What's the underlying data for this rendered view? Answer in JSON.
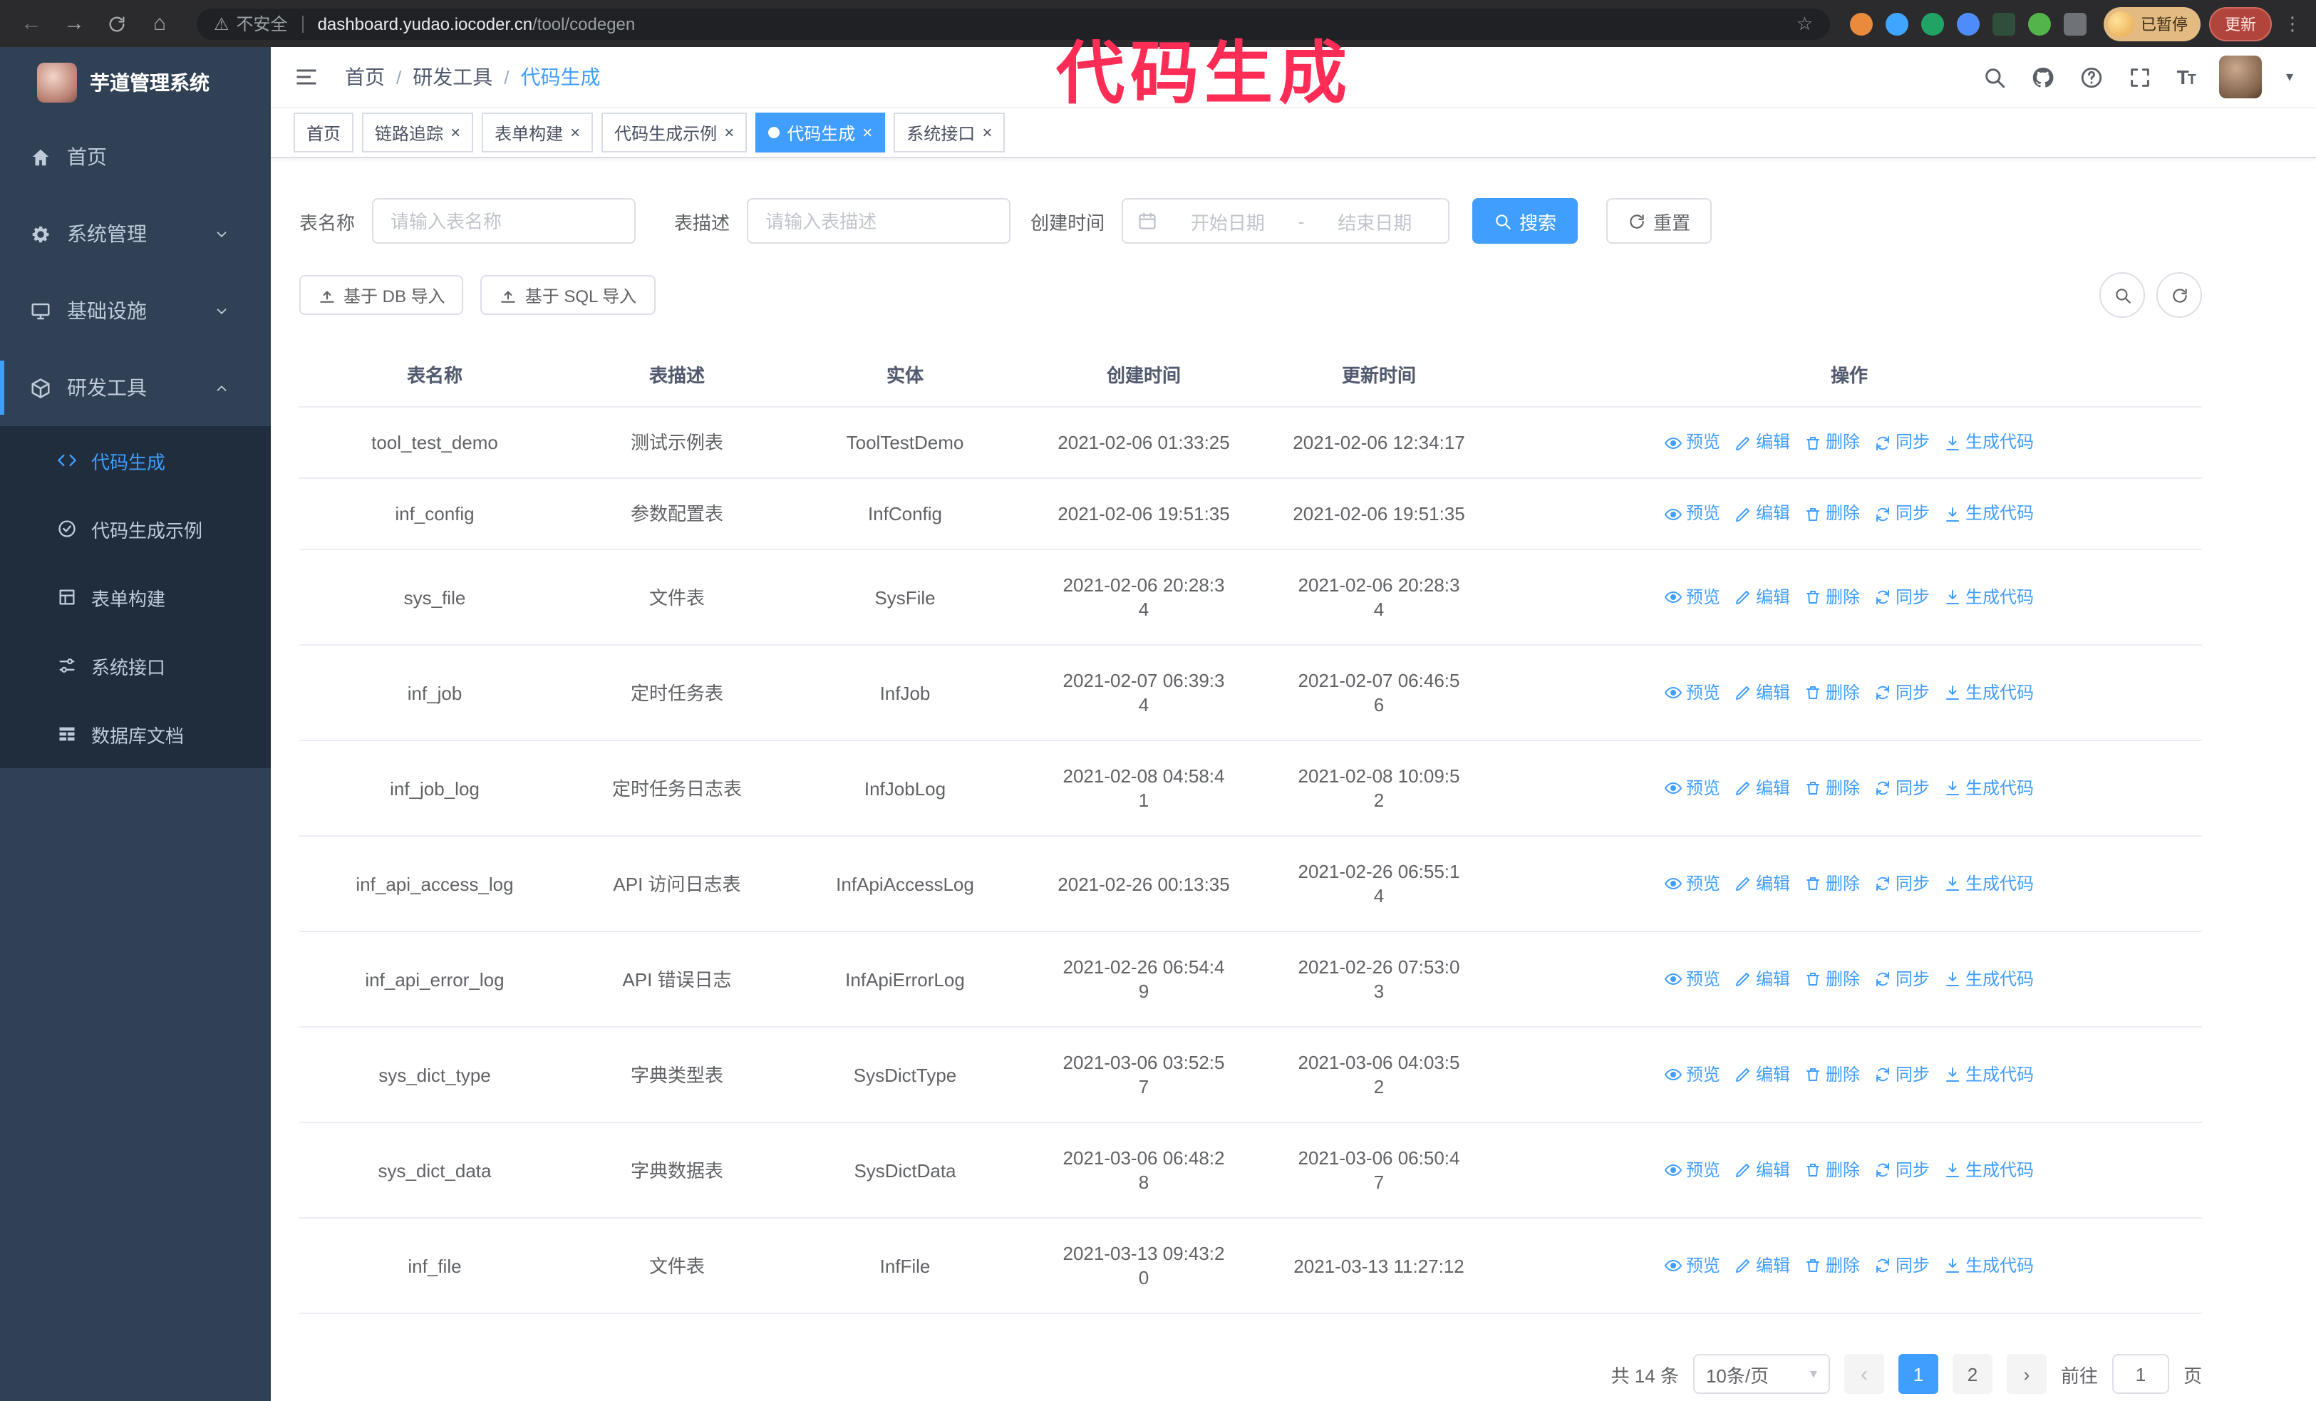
{
  "browser": {
    "security_label": "不安全",
    "url_host": "dashboard.yudao.iocoder.cn",
    "url_path": "/tool/codegen",
    "profile_status": "已暂停",
    "update_label": "更新"
  },
  "annotation": {
    "text": "代码生成",
    "color": "#ff2d55"
  },
  "sidebar": {
    "logo_title": "芋道管理系统",
    "items": [
      {
        "label": "首页",
        "icon": "home-icon"
      },
      {
        "label": "系统管理",
        "icon": "gear-icon"
      },
      {
        "label": "基础设施",
        "icon": "monitor-icon"
      },
      {
        "label": "研发工具",
        "icon": "cube-icon"
      }
    ],
    "submenu": [
      {
        "label": "代码生成",
        "icon": "code-icon",
        "active": true
      },
      {
        "label": "代码生成示例",
        "icon": "badge-check-icon"
      },
      {
        "label": "表单构建",
        "icon": "grid-icon"
      },
      {
        "label": "系统接口",
        "icon": "sliders-icon"
      },
      {
        "label": "数据库文档",
        "icon": "db-table-icon"
      }
    ]
  },
  "header": {
    "breadcrumb": [
      "首页",
      "研发工具",
      "代码生成"
    ],
    "separator": "/"
  },
  "tabs": [
    {
      "label": "首页",
      "closable": false,
      "active": false
    },
    {
      "label": "链路追踪",
      "closable": true,
      "active": false
    },
    {
      "label": "表单构建",
      "closable": true,
      "active": false
    },
    {
      "label": "代码生成示例",
      "closable": true,
      "active": false
    },
    {
      "label": "代码生成",
      "closable": true,
      "active": true
    },
    {
      "label": "系统接口",
      "closable": true,
      "active": false
    }
  ],
  "filters": {
    "table_name_label": "表名称",
    "table_name_placeholder": "请输入表名称",
    "table_desc_label": "表描述",
    "table_desc_placeholder": "请输入表描述",
    "create_time_label": "创建时间",
    "date_start_placeholder": "开始日期",
    "date_separator": "-",
    "date_end_placeholder": "结束日期",
    "search_button": "搜索",
    "reset_button": "重置"
  },
  "toolbar": {
    "import_db_button": "基于 DB 导入",
    "import_sql_button": "基于 SQL 导入"
  },
  "table": {
    "columns": [
      "表名称",
      "表描述",
      "实体",
      "创建时间",
      "更新时间",
      "操作"
    ],
    "actions": [
      {
        "label": "预览",
        "icon": "eye-icon",
        "name": "preview-link"
      },
      {
        "label": "编辑",
        "icon": "edit-icon",
        "name": "edit-link"
      },
      {
        "label": "删除",
        "icon": "delete-icon",
        "name": "delete-link"
      },
      {
        "label": "同步",
        "icon": "sync-icon",
        "name": "sync-link"
      },
      {
        "label": "生成代码",
        "icon": "download-icon",
        "name": "generate-code-link"
      }
    ],
    "rows": [
      {
        "name": "tool_test_demo",
        "desc": "测试示例表",
        "entity": "ToolTestDemo",
        "created": "2021-02-06 01:33:25",
        "updated": "2021-02-06 12:34:17"
      },
      {
        "name": "inf_config",
        "desc": "参数配置表",
        "entity": "InfConfig",
        "created": "2021-02-06 19:51:35",
        "updated": "2021-02-06 19:51:35"
      },
      {
        "name": "sys_file",
        "desc": "文件表",
        "entity": "SysFile",
        "created": "2021-02-06 20:28:3\n4",
        "updated": "2021-02-06 20:28:3\n4"
      },
      {
        "name": "inf_job",
        "desc": "定时任务表",
        "entity": "InfJob",
        "created": "2021-02-07 06:39:3\n4",
        "updated": "2021-02-07 06:46:5\n6"
      },
      {
        "name": "inf_job_log",
        "desc": "定时任务日志表",
        "entity": "InfJobLog",
        "created": "2021-02-08 04:58:4\n1",
        "updated": "2021-02-08 10:09:5\n2"
      },
      {
        "name": "inf_api_access_log",
        "desc": "API 访问日志表",
        "entity": "InfApiAccessLog",
        "created": "2021-02-26 00:13:35",
        "updated": "2021-02-26 06:55:1\n4"
      },
      {
        "name": "inf_api_error_log",
        "desc": "API 错误日志",
        "entity": "InfApiErrorLog",
        "created": "2021-02-26 06:54:4\n9",
        "updated": "2021-02-26 07:53:0\n3"
      },
      {
        "name": "sys_dict_type",
        "desc": "字典类型表",
        "entity": "SysDictType",
        "created": "2021-03-06 03:52:5\n7",
        "updated": "2021-03-06 04:03:5\n2"
      },
      {
        "name": "sys_dict_data",
        "desc": "字典数据表",
        "entity": "SysDictData",
        "created": "2021-03-06 06:48:2\n8",
        "updated": "2021-03-06 06:50:4\n7"
      },
      {
        "name": "inf_file",
        "desc": "文件表",
        "entity": "InfFile",
        "created": "2021-03-13 09:43:2\n0",
        "updated": "2021-03-13 11:27:12"
      }
    ]
  },
  "pagination": {
    "total": "共 14 条",
    "page_size": "10条/页",
    "pages": [
      "1",
      "2"
    ],
    "active_page": "1",
    "goto_label": "前往",
    "goto_value": "1",
    "goto_unit": "页"
  },
  "colors": {
    "accent": "#409eff",
    "sidebar_bg": "#304156",
    "submenu_bg": "#1f2d3d",
    "annotation": "#ff2d55"
  }
}
